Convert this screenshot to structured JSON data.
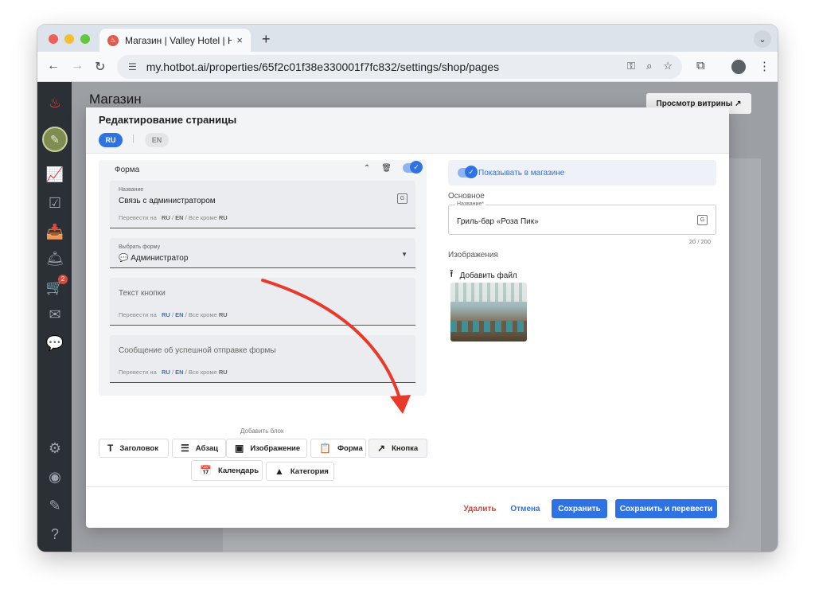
{
  "browser": {
    "tab_title": "Магазин | Valley Hotel | Hotbo",
    "url": "my.hotbot.ai/properties/65f2c01f38e330001f7fc832/settings/shop/pages",
    "new_tab": "+",
    "tab_close": "×"
  },
  "app": {
    "page_title": "Магазин",
    "storefront_button": "Просмотр витрины ↗",
    "cart_badge": "2"
  },
  "modal": {
    "title": "Редактирование страницы",
    "languages": [
      "RU",
      "EN"
    ],
    "form_block": {
      "title": "Форма",
      "name_field": {
        "label": "Название",
        "value": "Связь с администратором",
        "translate": {
          "prefix": "Перевести на",
          "ru": "RU",
          "en": "EN",
          "except": "Все кроме",
          "except_lang": "RU"
        }
      },
      "select_form": {
        "label": "Выбрать форму",
        "value": "💬 Администратор"
      },
      "button_text": {
        "placeholder": "Текст кнопки",
        "translate": {
          "prefix": "Перевести на",
          "ru": "RU",
          "en": "EN",
          "except": "Все кроме",
          "except_lang": "RU"
        }
      },
      "success_message": {
        "placeholder": "Сообщение об успешной отправке формы",
        "translate": {
          "prefix": "Перевести на",
          "ru": "RU",
          "en": "EN",
          "except": "Все кроме",
          "except_lang": "RU"
        }
      }
    },
    "add_block": {
      "label": "Добавить блок",
      "blocks": [
        "Заголовок",
        "Абзац",
        "Изображение",
        "Форма",
        "Кнопка",
        "Календарь",
        "Категория"
      ]
    },
    "right": {
      "show_in_shop": "Показывать в магазине",
      "section_main": "Основное",
      "name_label": "Название*",
      "name_value": "Гриль-бар «Роза Пик»",
      "counter": "20 / 200",
      "section_images": "Изображения",
      "add_file": "Добавить файл"
    },
    "footer": {
      "delete": "Удалить",
      "cancel": "Отмена",
      "save": "Сохранить",
      "save_translate": "Сохранить и перевести"
    }
  },
  "colors": {
    "accent": "#2f72e3",
    "danger": "#d8453b",
    "annotation_arrow": "#e8392b"
  }
}
